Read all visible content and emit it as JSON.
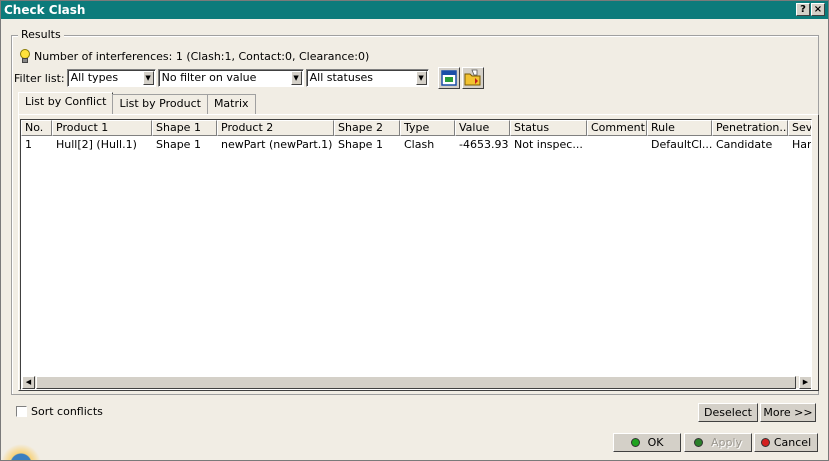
{
  "window": {
    "title": "Check Clash",
    "help_label": "?",
    "close_label": "×"
  },
  "results": {
    "group_label": "Results",
    "summary": "Number of interferences: 1 (Clash:1, Contact:0, Clearance:0)"
  },
  "filters": {
    "label": "Filter list:",
    "type": "All types",
    "value": "No filter on value",
    "status": "All statuses"
  },
  "tabs": [
    {
      "label": "List by Conflict",
      "active": true
    },
    {
      "label": "List by Product",
      "active": false
    },
    {
      "label": "Matrix",
      "active": false
    }
  ],
  "table": {
    "columns": [
      "No.",
      "Product 1",
      "Shape 1",
      "Product 2",
      "Shape 2",
      "Type",
      "Value",
      "Status",
      "Comment",
      "Rule",
      "Penetration...",
      "Sev"
    ],
    "rows": [
      [
        "1",
        "Hull[2] (Hull.1)",
        "Shape 1",
        "newPart (newPart.1)",
        "Shape 1",
        "Clash",
        "-4653.93",
        "Not inspec...",
        "",
        "DefaultCl...",
        "Candidate",
        "Har"
      ]
    ]
  },
  "options": {
    "sort_label": "Sort conflicts",
    "sort_checked": false
  },
  "buttons": {
    "deselect": "Deselect",
    "more": "More >>",
    "ok": "OK",
    "apply": "Apply",
    "cancel": "Cancel"
  },
  "icons": {
    "bulb": "lightbulb-icon",
    "export": "export-window-icon",
    "open": "open-folder-icon",
    "ok_dot": "#1fa31f",
    "apply_dot": "#2a7f2a",
    "cancel_dot": "#d42020"
  }
}
